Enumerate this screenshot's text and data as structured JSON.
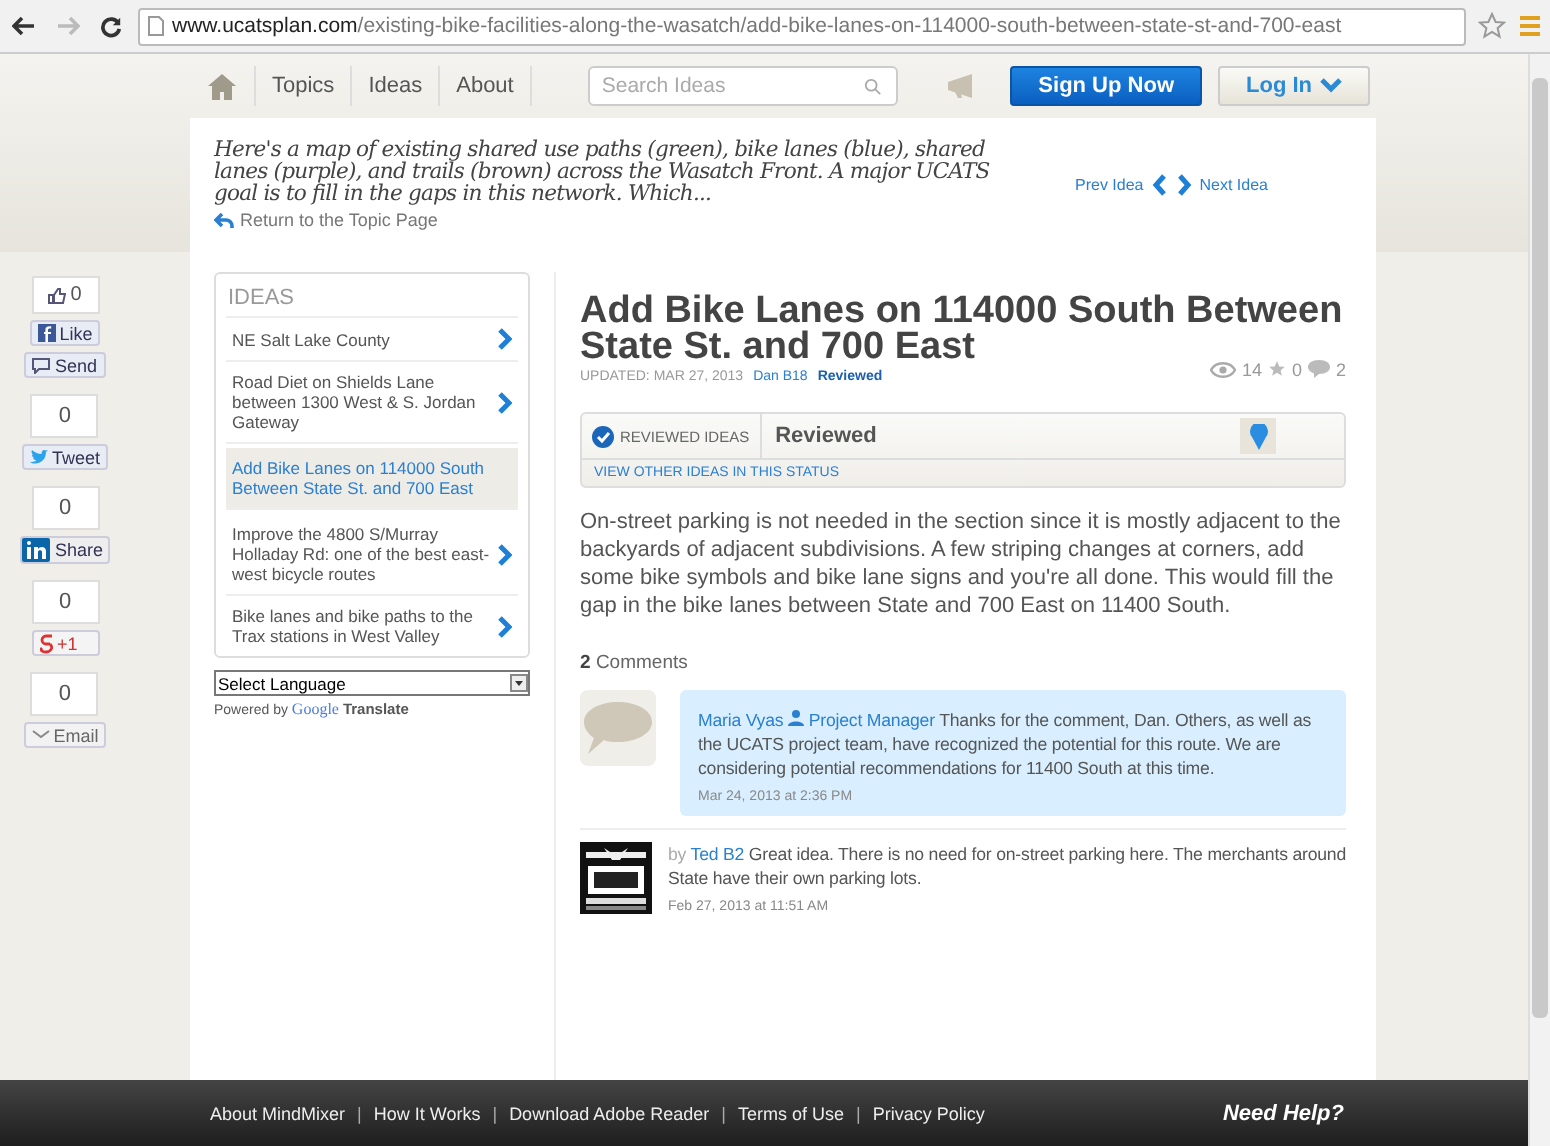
{
  "browser": {
    "url_domain": "www.ucatsplan.com",
    "url_path": "/existing-bike-facilities-along-the-wasatch/add-bike-lanes-on-114000-south-between-state-st-and-700-east"
  },
  "nav": {
    "items": [
      {
        "kind": "home"
      },
      {
        "kind": "text",
        "label": "Topics"
      },
      {
        "kind": "text",
        "label": "Ideas"
      },
      {
        "kind": "text",
        "label": "About"
      }
    ],
    "search_placeholder": "Search Ideas",
    "sign_up": "Sign Up Now",
    "log_in": "Log In"
  },
  "intro": {
    "text": "Here's a map of existing shared use paths (green), bike lanes (blue), shared lanes (purple), and trails (brown) across the Wasatch Front. A major UCATS goal is to fill in the gaps in this network. Which...",
    "return_link": "Return to the Topic Page",
    "prev": "Prev Idea",
    "next": "Next Idea"
  },
  "social": [
    {
      "kind": "facebook",
      "count": "0",
      "buttons": [
        {
          "kind": "like",
          "label": "Like"
        },
        {
          "kind": "send",
          "label": "Send"
        }
      ]
    },
    {
      "kind": "twitter",
      "count": "0",
      "buttons": [
        {
          "kind": "tweet",
          "label": "Tweet"
        }
      ]
    },
    {
      "kind": "linkedin",
      "count": "0",
      "buttons": [
        {
          "kind": "share",
          "label": "Share"
        }
      ]
    },
    {
      "kind": "google",
      "count": "0",
      "buttons": [
        {
          "kind": "plusone",
          "label": "+1"
        }
      ]
    },
    {
      "kind": "email",
      "count": "0",
      "buttons": [
        {
          "kind": "email",
          "label": "Email"
        }
      ]
    }
  ],
  "ideas": {
    "heading": "IDEAS",
    "items": [
      {
        "text": "NE Salt Lake County",
        "selected": false
      },
      {
        "text": "Road Diet on Shields Lane between 1300 West & S. Jordan Gateway",
        "selected": false
      },
      {
        "text": "Add Bike Lanes on 114000 South Between State St. and 700 East",
        "selected": true
      },
      {
        "text": "Improve the 4800 S/Murray Holladay Rd: one of the best east-west bicycle routes",
        "selected": false
      },
      {
        "text": "Bike lanes and bike paths to the Trax stations in West Valley",
        "selected": false
      }
    ],
    "language": "Select Language",
    "powered_by": "Powered by",
    "google": "Google",
    "translate": "Translate"
  },
  "idea": {
    "title": "Add Bike Lanes on 114000 South Between State St. and 700 East",
    "updated": "UPDATED: MAR 27, 2013",
    "author": "Dan B18",
    "author_status": "Reviewed",
    "views": "14",
    "stars_count": "0",
    "comments_count": "2",
    "status": {
      "label": "REVIEWED IDEAS",
      "value": "Reviewed",
      "link": "VIEW OTHER IDEAS IN THIS STATUS"
    },
    "body": "On-street parking is not needed in the section since it is mostly adjacent to the backyards of adjacent subdivisions. A few striping changes at corners, add some bike symbols and bike lane signs and you're all done. This would fill the gap in the bike lanes between State and 700 East on 11400 South."
  },
  "comments_header": {
    "count": "2",
    "label": "Comments"
  },
  "comments": [
    {
      "kind": "staff",
      "author": "Maria Vyas",
      "role": "Project Manager",
      "text": "Thanks for the comment, Dan. Others, as well as the UCATS project team, have recognized the potential for this route. We are considering potential recommendations for 11400 South at this time.",
      "time": "Mar 24, 2013 at 2:36 PM"
    },
    {
      "kind": "user",
      "by": "by",
      "author": "Ted B2",
      "text": "Great idea. There is no need for on-street parking here. The merchants around State have their own parking lots.",
      "time": "Feb 27, 2013 at 11:51 AM"
    }
  ],
  "footer": {
    "links": [
      "About MindMixer",
      "How It Works",
      "Download Adobe Reader",
      "Terms of Use",
      "Privacy Policy"
    ],
    "separator": "|",
    "help": "Need Help?"
  }
}
